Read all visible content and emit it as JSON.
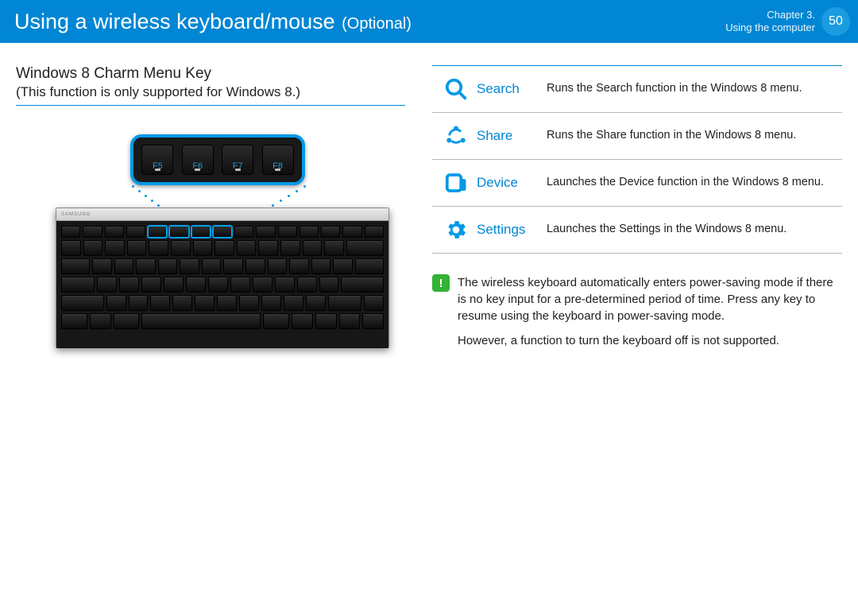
{
  "header": {
    "title": "Using a wireless keyboard/mouse",
    "optional": "(Optional)",
    "chapter_line1": "Chapter 3.",
    "chapter_line2": "Using the computer",
    "page_number": "50"
  },
  "left": {
    "subheading": "Windows 8 Charm Menu Key",
    "support_note": "(This function is only supported for Windows 8.)",
    "brand": "SAMSUNG",
    "zoom_keys": [
      "F5",
      "F6",
      "F7",
      "F8"
    ]
  },
  "functions": [
    {
      "icon": "search-icon",
      "label": "Search",
      "desc_pre": "Runs the ",
      "desc_bold": "Search",
      "desc_post": " function in the Windows 8 menu."
    },
    {
      "icon": "share-icon",
      "label": "Share",
      "desc_pre": "Runs the ",
      "desc_bold": "Share",
      "desc_post": " function in the Windows 8 menu."
    },
    {
      "icon": "device-icon",
      "label": "Device",
      "desc_pre": "Launches the ",
      "desc_bold": "Device",
      "desc_post": " function in the Windows 8 menu."
    },
    {
      "icon": "settings-icon",
      "label": "Settings",
      "desc_pre": "Launches the ",
      "desc_bold": "Settings",
      "desc_post": " in the Windows 8 menu."
    }
  ],
  "note": {
    "p1": "The wireless keyboard automatically enters power-saving mode if there is no key input for a pre-determined period of time. Press any key to resume using the keyboard in power-saving mode.",
    "p2": "However, a function to turn the keyboard off is not supported."
  }
}
